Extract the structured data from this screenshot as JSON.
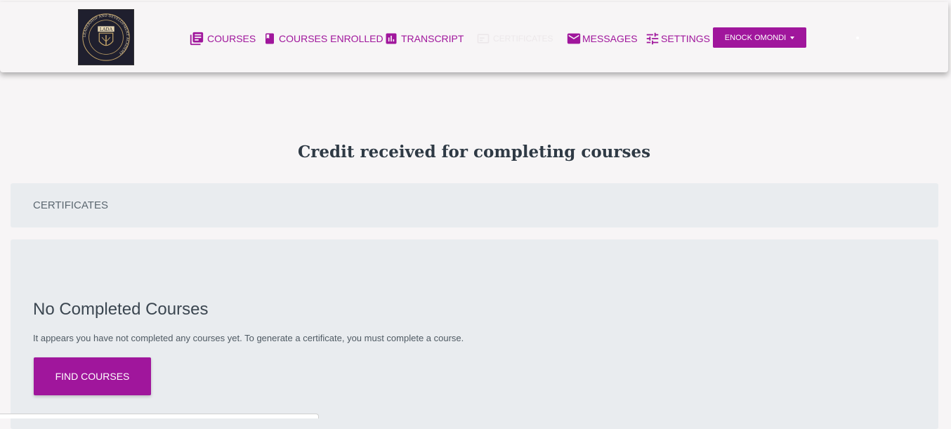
{
  "brand": {
    "logo_text": "LADA",
    "logo_ring_text": "LEADERSHIP AND DEVELOPMENT ACADEMY"
  },
  "nav": {
    "items": [
      {
        "label": "COURSES",
        "icon": "library-books-icon"
      },
      {
        "label": "COURSES ENROLLED",
        "icon": "bookmark-book-icon"
      },
      {
        "label": "TRANSCRIPT",
        "icon": "bar-chart-icon"
      },
      {
        "label": "CERTIFICATES",
        "icon": "certificate-icon",
        "state": "active"
      },
      {
        "label": "MESSAGES",
        "icon": "mail-icon"
      },
      {
        "label": "SETTINGS",
        "icon": "tune-icon"
      }
    ],
    "user_label": "ENOCK OMONDI"
  },
  "main": {
    "title": "Credit received for completing courses",
    "section_header": "CERTIFICATES",
    "empty_title": "No Completed Courses",
    "empty_text": "It appears you have not completed any courses yet. To generate a certificate, you must complete a course.",
    "find_button": "FIND COURSES"
  },
  "colors": {
    "accent": "#a0169c",
    "background": "#f7f5f6",
    "card": "#e9ecef",
    "title": "#2f3a45"
  }
}
